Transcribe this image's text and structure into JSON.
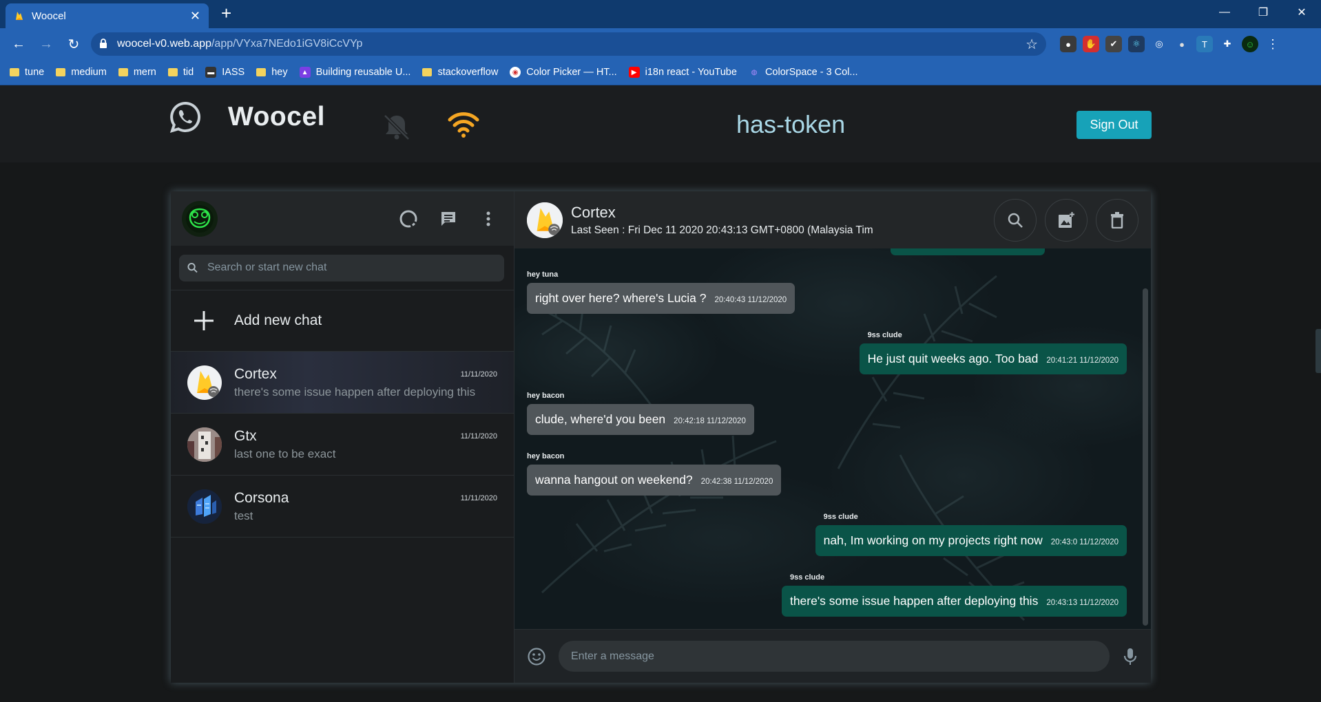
{
  "browser": {
    "tab_title": "Woocel",
    "url_host": "woocel-v0.web.app",
    "url_path": "/app/VYxa7NEdo1iGV8iCcVYp",
    "bookmarks": [
      {
        "label": "tune",
        "type": "folder"
      },
      {
        "label": "medium",
        "type": "folder"
      },
      {
        "label": "mern",
        "type": "folder"
      },
      {
        "label": "tid",
        "type": "folder"
      },
      {
        "label": "IASS",
        "type": "site"
      },
      {
        "label": "hey",
        "type": "folder"
      },
      {
        "label": "Building reusable U...",
        "type": "site"
      },
      {
        "label": "stackoverflow",
        "type": "folder"
      },
      {
        "label": "Color Picker — HT...",
        "type": "site"
      },
      {
        "label": "i18n react - YouTube",
        "type": "site"
      },
      {
        "label": "ColorSpace - 3 Col...",
        "type": "site"
      }
    ]
  },
  "header": {
    "brand": "Woocel",
    "status": "has-token",
    "signout_label": "Sign Out",
    "accent": "#17a2b8",
    "wifi_color": "#f5a623"
  },
  "sidebar": {
    "search_placeholder": "Search or start new chat",
    "add_chat_label": "Add new chat",
    "chats": [
      {
        "name": "Cortex",
        "date": "11/11/2020",
        "preview": "there's some issue happen after deploying this",
        "active": true
      },
      {
        "name": "Gtx",
        "date": "11/11/2020",
        "preview": "last one to be exact",
        "active": false
      },
      {
        "name": "Corsona",
        "date": "11/11/2020",
        "preview": "test",
        "active": false
      }
    ]
  },
  "conversation": {
    "name": "Cortex",
    "last_seen": "Last Seen : Fri Dec 11 2020 20:43:13 GMT+0800 (Malaysia Tim",
    "messages": [
      {
        "sender": "hey tuna",
        "text": "right over here? where's Lucia ?",
        "time": "20:40:43 11/12/2020",
        "direction": "in"
      },
      {
        "sender": "9ss clude",
        "text": "He just quit weeks ago. Too bad",
        "time": "20:41:21 11/12/2020",
        "direction": "out"
      },
      {
        "sender": "hey bacon",
        "text": "clude, where'd you been",
        "time": "20:42:18 11/12/2020",
        "direction": "in"
      },
      {
        "sender": "hey bacon",
        "text": "wanna hangout on weekend?",
        "time": "20:42:38 11/12/2020",
        "direction": "in"
      },
      {
        "sender": "9ss clude",
        "text": "nah, Im working on my projects right now",
        "time": "20:43:0 11/12/2020",
        "direction": "out"
      },
      {
        "sender": "9ss clude",
        "text": "there's some issue happen after deploying this",
        "time": "20:43:13 11/12/2020",
        "direction": "out"
      }
    ],
    "composer_placeholder": "Enter a message"
  }
}
